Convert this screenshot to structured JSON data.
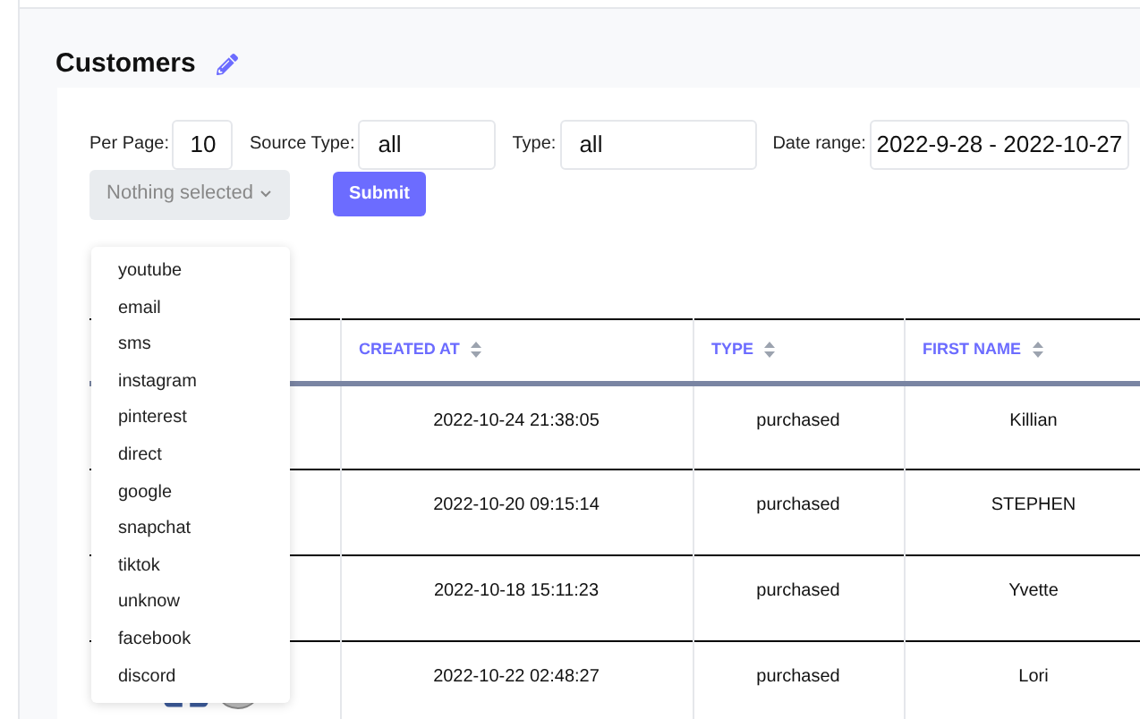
{
  "page_title": "Customers",
  "filters": [
    {
      "label": "Per Page:",
      "value": "10",
      "kind": "narrow"
    },
    {
      "label": "Source Type:",
      "value": "all",
      "kind": "medium"
    },
    {
      "label": "Type:",
      "value": "all",
      "kind": "wide"
    },
    {
      "label": "Date range:",
      "value": "2022-9-28 - 2022-10-27",
      "kind": "date"
    }
  ],
  "source_select": {
    "placeholder": "Nothing selected",
    "expanded": true,
    "options": [
      "youtube",
      "email",
      "sms",
      "instagram",
      "pinterest",
      "direct",
      "google",
      "snapchat",
      "tiktok",
      "unknow",
      "facebook",
      "discord"
    ]
  },
  "submit_button": "Submit",
  "table": {
    "columns": [
      "CREATED AT",
      "TYPE",
      "FIRST NAME"
    ],
    "rows": [
      {
        "created_at": "2022-10-24 21:38:05",
        "type": "purchased",
        "first_name": "Killian",
        "source_icons_shown": false
      },
      {
        "created_at": "2022-10-20 09:15:14",
        "type": "purchased",
        "first_name": "STEPHEN",
        "source_icons_shown": false
      },
      {
        "created_at": "2022-10-18 15:11:23",
        "type": "purchased",
        "first_name": "Yvette",
        "source_icons_shown": false
      },
      {
        "created_at": "2022-10-22 02:48:27",
        "type": "purchased",
        "first_name": "Lori",
        "source_icons_shown": true
      }
    ]
  }
}
